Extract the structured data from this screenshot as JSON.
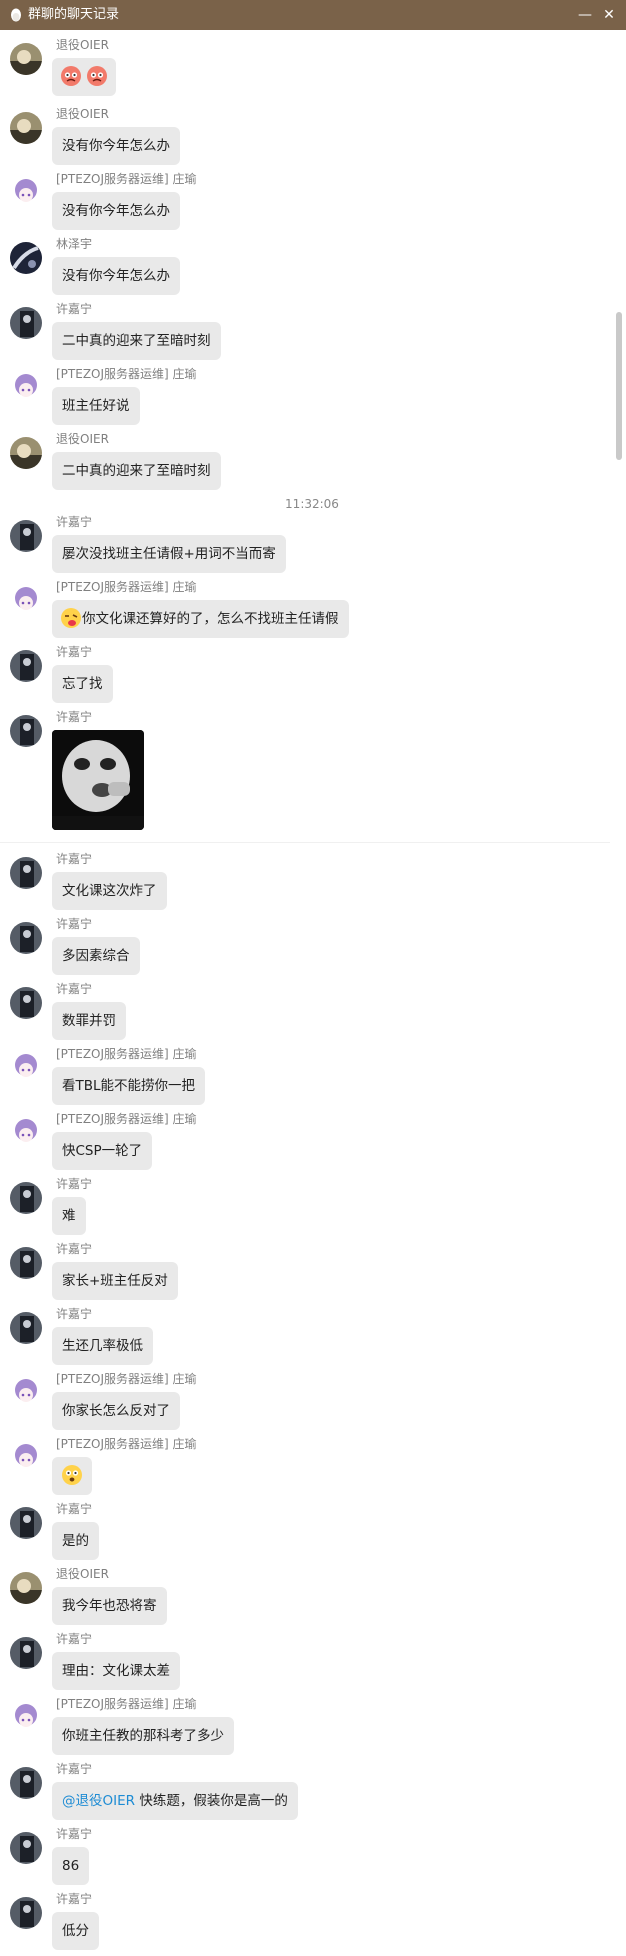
{
  "window": {
    "title": "群聊的聊天记录",
    "app_icon": "qq-penguin-icon",
    "minimize_symbol": "—",
    "close_symbol": "✕",
    "titlebar_color": "#7a6249"
  },
  "senders": {
    "oier": "退役OIER",
    "zhuang": "[PTEZOJ服务器运维] 庄瑜",
    "lin": "林泽宇",
    "xu": "许嘉宁"
  },
  "timestamp": "11:32:06",
  "messages": [
    {
      "sender": "退役OIER",
      "text": ""
    },
    {
      "sender": "退役OIER",
      "text": "没有你今年怎么办"
    },
    {
      "sender": "[PTEZOJ服务器运维] 庄瑜",
      "text": "没有你今年怎么办"
    },
    {
      "sender": "林泽宇",
      "text": "没有你今年怎么办"
    },
    {
      "sender": "许嘉宁",
      "text": "二中真的迎来了至暗时刻"
    },
    {
      "sender": "[PTEZOJ服务器运维] 庄瑜",
      "text": "班主任好说"
    },
    {
      "sender": "退役OIER",
      "text": "二中真的迎来了至暗时刻"
    },
    {
      "sender": "许嘉宁",
      "text": "屡次没找班主任请假+用词不当而寄"
    },
    {
      "sender": "[PTEZOJ服务器运维] 庄瑜",
      "text": "你文化课还算好的了，怎么不找班主任请假"
    },
    {
      "sender": "许嘉宁",
      "text": "忘了找"
    },
    {
      "sender": "许嘉宁",
      "text": ""
    },
    {
      "sender": "许嘉宁",
      "text": "文化课这次炸了"
    },
    {
      "sender": "许嘉宁",
      "text": "多因素综合"
    },
    {
      "sender": "许嘉宁",
      "text": "数罪并罚"
    },
    {
      "sender": "[PTEZOJ服务器运维] 庄瑜",
      "text": "看TBL能不能捞你一把"
    },
    {
      "sender": "[PTEZOJ服务器运维] 庄瑜",
      "text": "快CSP一轮了"
    },
    {
      "sender": "许嘉宁",
      "text": "难"
    },
    {
      "sender": "许嘉宁",
      "text": "家长+班主任反对"
    },
    {
      "sender": "许嘉宁",
      "text": "生还几率极低"
    },
    {
      "sender": "[PTEZOJ服务器运维] 庄瑜",
      "text": "你家长怎么反对了"
    },
    {
      "sender": "[PTEZOJ服务器运维] 庄瑜",
      "text": ""
    },
    {
      "sender": "许嘉宁",
      "text": "是的"
    },
    {
      "sender": "退役OIER",
      "text": "我今年也恐将寄"
    },
    {
      "sender": "许嘉宁",
      "text": "理由：文化课太差"
    },
    {
      "sender": "[PTEZOJ服务器运维] 庄瑜",
      "text": "你班主任教的那科考了多少"
    },
    {
      "sender": "许嘉宁",
      "mention": "@退役OIER",
      "text": " 快练题，假装你是高一的"
    },
    {
      "sender": "许嘉宁",
      "text": "86"
    },
    {
      "sender": "许嘉宁",
      "text": "低分"
    }
  ]
}
